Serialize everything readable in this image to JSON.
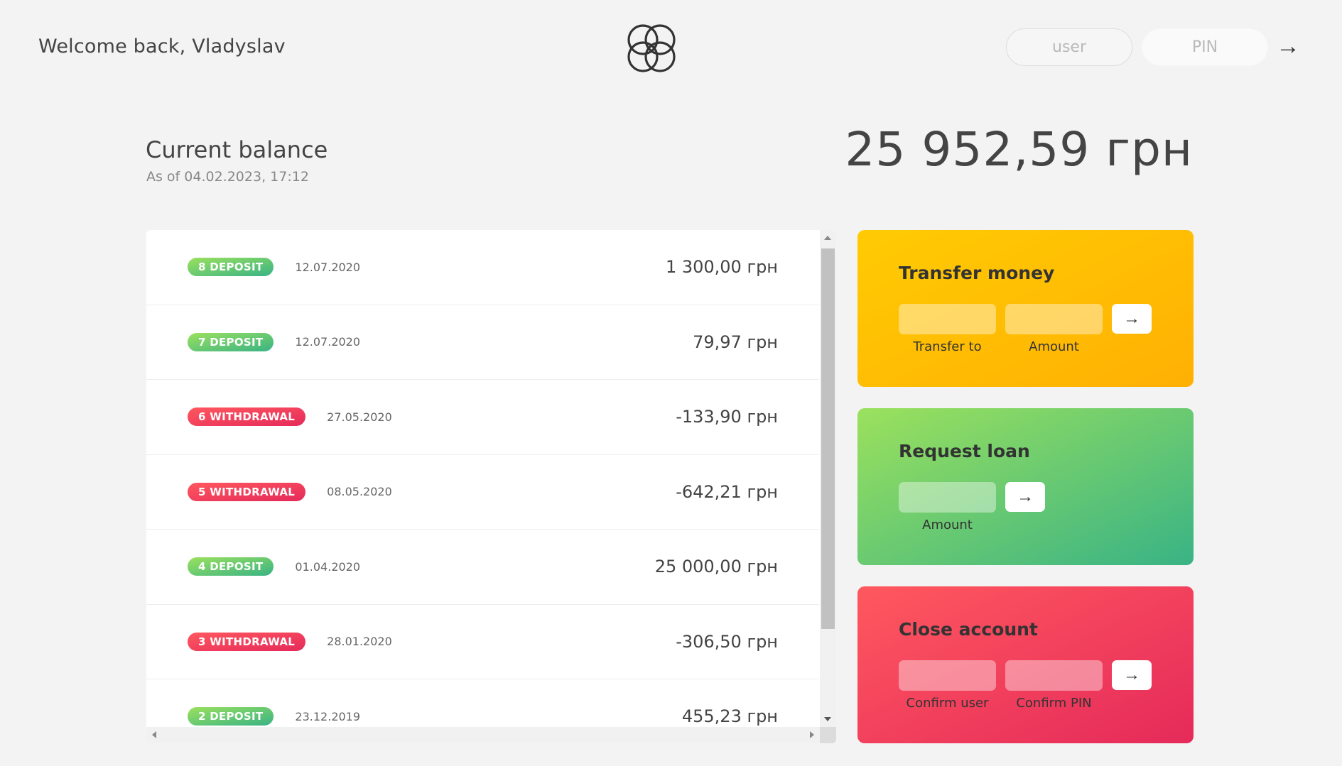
{
  "header": {
    "welcome": "Welcome back, Vladyslav",
    "login": {
      "user_placeholder": "user",
      "pin_placeholder": "PIN",
      "submit_label": "→"
    }
  },
  "balance": {
    "title": "Current balance",
    "date": "As of 04.02.2023, 17:12",
    "amount": "25 952,59 грн"
  },
  "movements": [
    {
      "type_label": "8 DEPOSIT",
      "kind": "deposit",
      "date": "12.07.2020",
      "value": "1 300,00 грн"
    },
    {
      "type_label": "7 DEPOSIT",
      "kind": "deposit",
      "date": "12.07.2020",
      "value": "79,97 грн"
    },
    {
      "type_label": "6 WITHDRAWAL",
      "kind": "withdrawal",
      "date": "27.05.2020",
      "value": "-133,90 грн"
    },
    {
      "type_label": "5 WITHDRAWAL",
      "kind": "withdrawal",
      "date": "08.05.2020",
      "value": "-642,21 грн"
    },
    {
      "type_label": "4 DEPOSIT",
      "kind": "deposit",
      "date": "01.04.2020",
      "value": "25 000,00 грн"
    },
    {
      "type_label": "3 WITHDRAWAL",
      "kind": "withdrawal",
      "date": "28.01.2020",
      "value": "-306,50 грн"
    },
    {
      "type_label": "2 DEPOSIT",
      "kind": "deposit",
      "date": "23.12.2019",
      "value": "455,23 грн"
    }
  ],
  "operations": {
    "transfer": {
      "title": "Transfer money",
      "to_label": "Transfer to",
      "amount_label": "Amount",
      "button": "→"
    },
    "loan": {
      "title": "Request loan",
      "amount_label": "Amount",
      "button": "→"
    },
    "close": {
      "title": "Close account",
      "user_label": "Confirm user",
      "pin_label": "Confirm PIN",
      "button": "→"
    }
  },
  "colors": {
    "deposit": "#9be15d",
    "withdrawal": "#e52a5a",
    "transfer": "#ffb003",
    "loan": "#39b385",
    "close": "#ff585f"
  }
}
